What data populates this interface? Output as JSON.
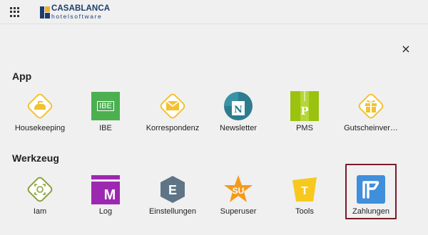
{
  "header": {
    "brand": "CASABLANCA",
    "brand_sub": "hotelsoftware"
  },
  "close_glyph": "×",
  "sections": {
    "app": {
      "title": "App",
      "items": [
        {
          "label": "Housekeeping",
          "icon": "iron-icon"
        },
        {
          "label": "IBE",
          "icon": "ibe-icon",
          "icon_text": "IBE"
        },
        {
          "label": "Korrespondenz",
          "icon": "envelope-icon"
        },
        {
          "label": "Newsletter",
          "icon": "newsletter-icon",
          "icon_text": "N"
        },
        {
          "label": "PMS",
          "icon": "pms-icon",
          "icon_text": "P"
        },
        {
          "label": "Gutscheinver…",
          "icon": "gift-icon"
        }
      ]
    },
    "tools": {
      "title": "Werkzeug",
      "items": [
        {
          "label": "Iam",
          "icon": "face-scan-icon"
        },
        {
          "label": "Log",
          "icon": "log-icon",
          "icon_text": "M"
        },
        {
          "label": "Einstellungen",
          "icon": "settings-hexagon-icon",
          "icon_text": "E"
        },
        {
          "label": "Superuser",
          "icon": "star-icon",
          "icon_text": "SU"
        },
        {
          "label": "Tools",
          "icon": "tools-icon",
          "icon_text": "T"
        },
        {
          "label": "Zahlungen",
          "icon": "payment-icon",
          "selected": true
        }
      ]
    }
  },
  "colors": {
    "yellow": "#f2c230",
    "ibe_green": "#4caf50",
    "newsletter_teal": "#2d7d8e",
    "pms_green": "#9bc20e",
    "log_purple": "#9c27b0",
    "hexagon_grey": "#5f7486",
    "star_orange": "#f49b1c",
    "payment_blue": "#3f8fdc",
    "selection_border": "#7a1a2a",
    "brand_navy": "#1c3c6d"
  }
}
